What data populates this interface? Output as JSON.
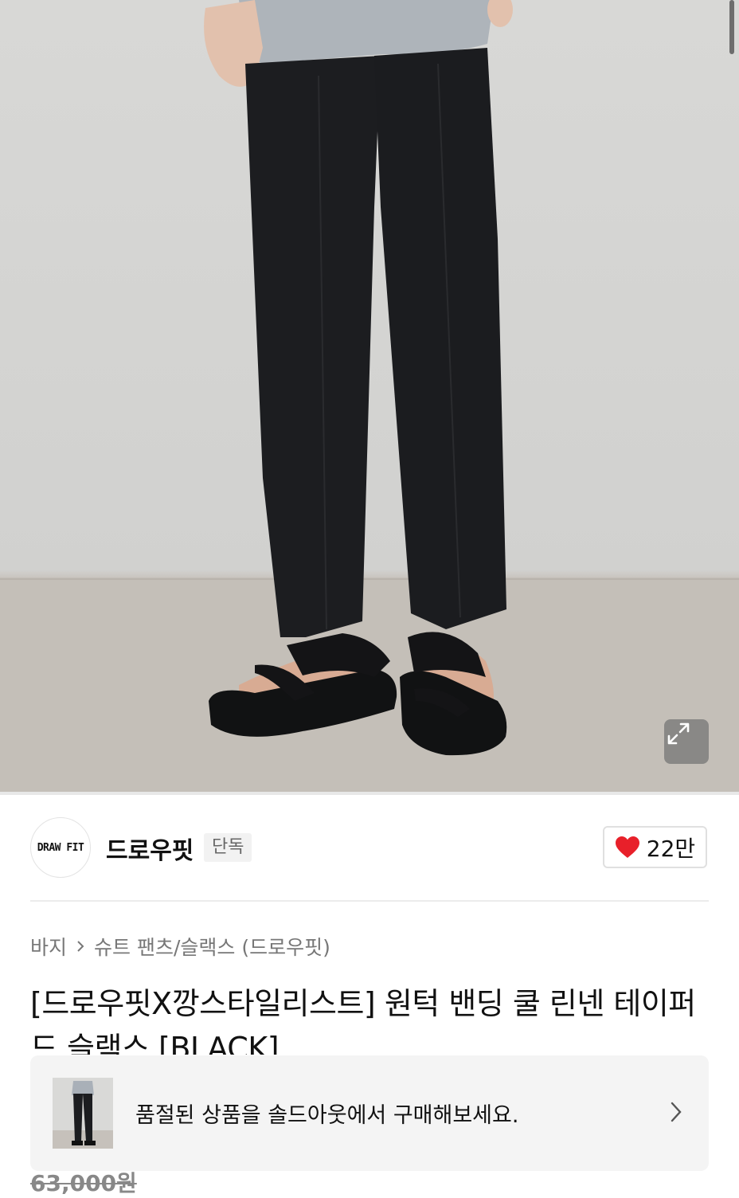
{
  "brand": {
    "logo_text": "DRAW FIT",
    "name": "드로우핏",
    "badge": "단독"
  },
  "like": {
    "icon": "heart-icon",
    "count": "22만",
    "color": "#e8202a"
  },
  "breadcrumb": {
    "items": [
      "바지",
      "슈트 팬츠/슬랙스 (드로우핏)"
    ]
  },
  "product": {
    "title": "[드로우핏X깡스타일리스트] 원턱 밴딩 쿨 린넨 테이퍼드 슬랙스 [BLACK]",
    "original_price": "63,000원"
  },
  "soldout_banner": {
    "text": "품절된 상품을 솔드아웃에서 구매해보세요."
  },
  "icons": {
    "expand": "expand-icon",
    "chevron": "chevron-right-icon"
  }
}
